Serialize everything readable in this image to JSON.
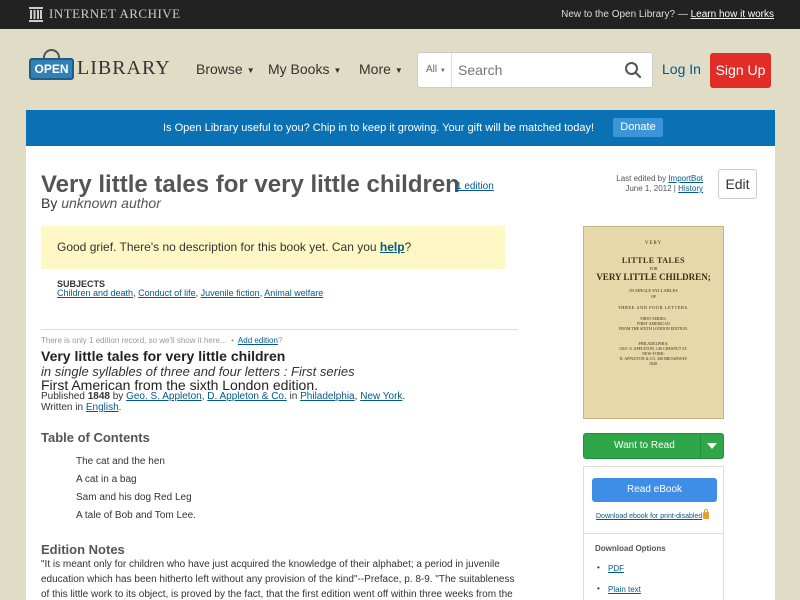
{
  "ia_bar": {
    "logo_text": "INTERNET ARCHIVE",
    "prompt_text": "New to the Open Library? —",
    "prompt_link": "Learn how it works"
  },
  "header": {
    "logo_open": "OPEN",
    "logo_library": "LIBRARY",
    "nav": {
      "browse": "Browse",
      "my_books": "My Books",
      "more": "More"
    },
    "search": {
      "scope": "All",
      "placeholder": "Search"
    },
    "login": "Log In",
    "signup": "Sign Up"
  },
  "banner": {
    "text": "Is Open Library useful to you? Chip in to keep it growing. Your gift will be matched today!",
    "donate": "Donate"
  },
  "work": {
    "title": "Very little tales for very little children",
    "edition_count": "1 edition",
    "by_prefix": "By",
    "author": "unknown author",
    "last_edited_prefix": "Last edited by",
    "last_edited_by": "ImportBot",
    "last_edited_date": "June 1, 2012",
    "history": "History",
    "edit": "Edit"
  },
  "description": {
    "text": "Good grief. There's no description for this book yet. Can you",
    "help": "help",
    "end": "?"
  },
  "subjects": {
    "label": "SUBJECTS",
    "items": [
      "Children and death",
      "Conduct of life",
      "Juvenile fiction",
      "Animal welfare"
    ]
  },
  "edition": {
    "only_one": "There is only 1 edition record, so we'll show it here...",
    "sep": "•",
    "add_edition": "Add edition",
    "add_edition_q": "?",
    "title": "Very little tales for very little children",
    "subtitle": "in single syllables of three and four letters : First series",
    "edition_name": "First American from the sixth London edition.",
    "published_label": "Published",
    "year": "1848",
    "by": "by",
    "publishers": [
      "Geo. S. Appleton",
      "D. Appleton & Co."
    ],
    "in": "in",
    "places": [
      "Philadelphia",
      "New York"
    ],
    "written_label": "Written in",
    "language": "English"
  },
  "toc": {
    "heading": "Table of Contents",
    "items": [
      "The cat and the hen",
      "A cat in a bag",
      "Sam and his dog Red Leg",
      "A tale of Bob and Tom Lee."
    ]
  },
  "notes": {
    "heading": "Edition Notes",
    "text": "\"It is meant only for children who have just acquired the knowledge of their alphabet; a period in juvenile education which has been hitherto left without any provision of the kind\"--Preface, p. 8-9. \"The suitableness of this little work to its object, is proved by the fact, that the first edition went off within three weeks from the day of its publication,"
  },
  "cover": {
    "line1": "VERY",
    "line2": "LITTLE TALES",
    "line3": "FOR",
    "line4": "VERY LITTLE CHILDREN;",
    "line5": "IN SINGLE SYLLABLES",
    "line6": "OF",
    "line7": "THREE AND FOUR LETTERS.",
    "line8": "FIRST SERIES.",
    "line9": "FIRST AMERICAN",
    "line10": "FROM THE SIXTH LONDON EDITION.",
    "line11": "PHILADELPHIA:",
    "line12": "GEO. S. APPLETON, 148 CHESNUT ST.",
    "line13": "NEW-YORK:",
    "line14": "D. APPLETON & CO. 200 BROADWAY.",
    "line15": "1848."
  },
  "sidebar": {
    "want_to_read": "Want to Read",
    "read_ebook": "Read eBook",
    "download_ebook": "Download ebook for print-disabled",
    "download_options": "Download Options",
    "downloads": [
      "PDF",
      "Plain text"
    ]
  },
  "colors": {
    "ia_bar": "#222222",
    "page_bg": "#e1dcc5",
    "banner": "#0b71b5",
    "signup": "#e22c27",
    "want_to_read": "#2fa749",
    "read_ebook": "#3e8ee7",
    "link": "#02598b"
  }
}
